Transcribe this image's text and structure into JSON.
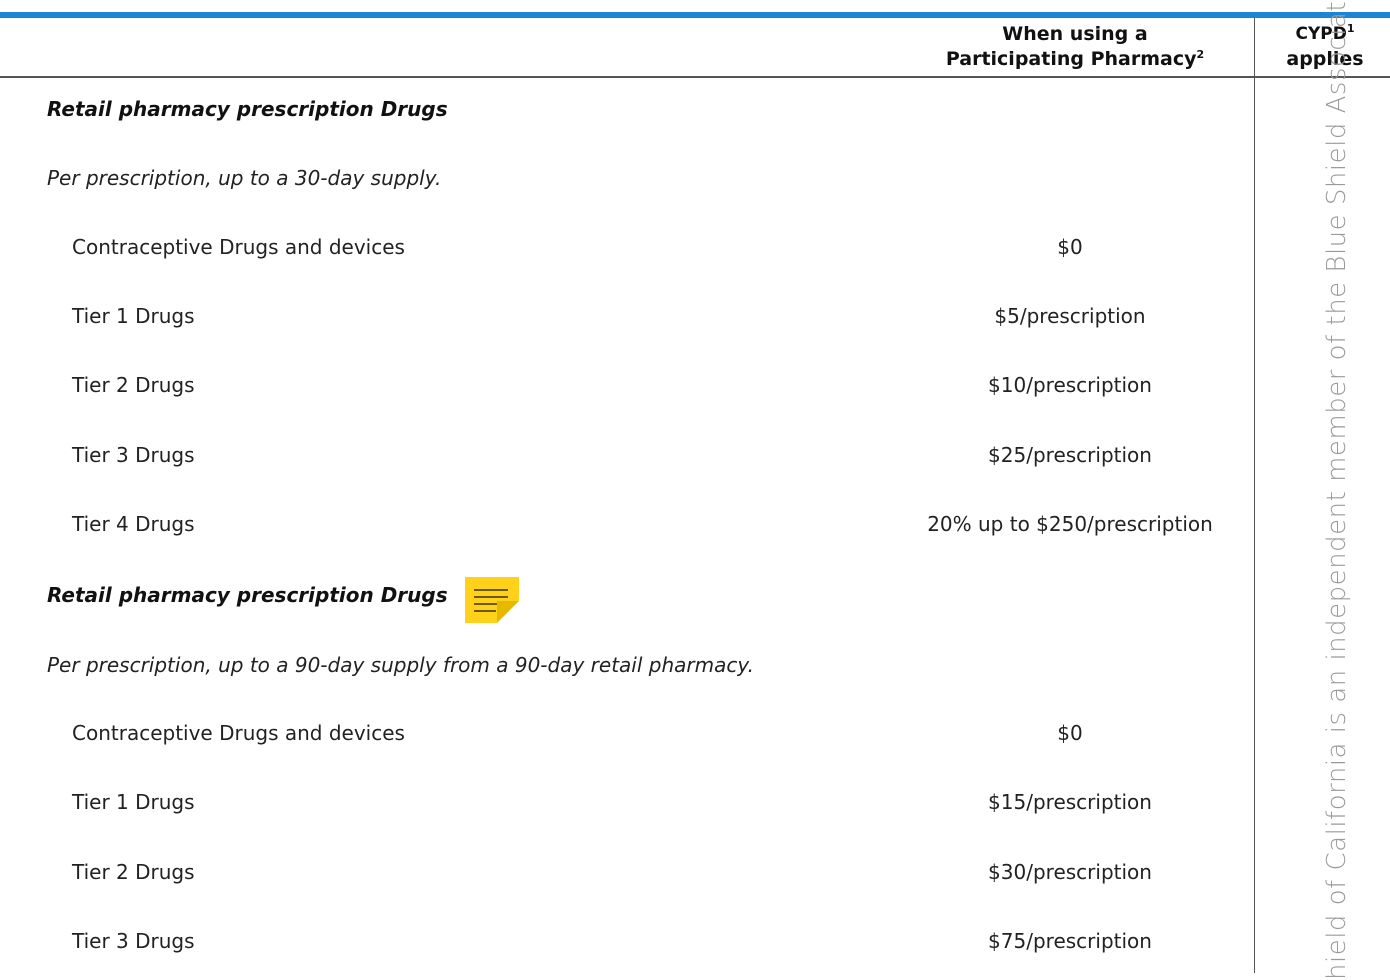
{
  "header": {
    "pharmacy_col_line1": "When using a",
    "pharmacy_col_line2": "Participating Pharmacy",
    "pharmacy_col_sup": "2",
    "cypd_col_line1": "CYPD",
    "cypd_col_sup": "1",
    "cypd_col_line2": "applies"
  },
  "sections": [
    {
      "title": "Retail pharmacy prescription Drugs",
      "subtitle": "Per prescription, up to a 30-day supply.",
      "rows": [
        {
          "label": "Contraceptive Drugs and devices",
          "value": "$0"
        },
        {
          "label": "Tier 1 Drugs",
          "value": "$5/prescription"
        },
        {
          "label": "Tier 2 Drugs",
          "value": "$10/prescription"
        },
        {
          "label": "Tier 3 Drugs",
          "value": "$25/prescription"
        },
        {
          "label": "Tier 4 Drugs",
          "value": "20% up to $250/prescription"
        }
      ]
    },
    {
      "title": "Retail pharmacy prescription Drugs",
      "subtitle": "Per prescription, up to a 90-day supply from a 90-day retail pharmacy.",
      "rows": [
        {
          "label": "Contraceptive Drugs and devices",
          "value": "$0"
        },
        {
          "label": "Tier 1 Drugs",
          "value": "$15/prescription"
        },
        {
          "label": "Tier 2 Drugs",
          "value": "$30/prescription"
        },
        {
          "label": "Tier 3 Drugs",
          "value": "$75/prescription"
        }
      ]
    }
  ],
  "watermark": "hield of California is an independent member of the Blue Shield Association",
  "icons": {
    "note": "sticky-note-icon"
  },
  "colors": {
    "top_rule": "#1e84d4",
    "note": "#ffd11a"
  }
}
